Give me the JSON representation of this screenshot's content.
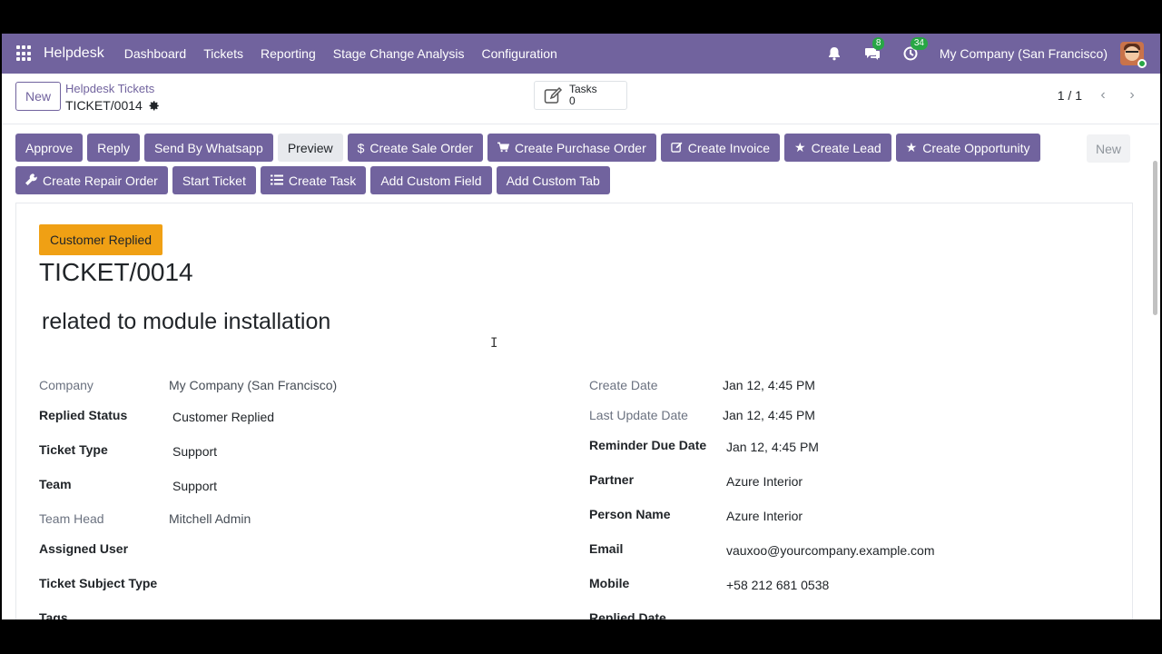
{
  "navbar": {
    "brand": "Helpdesk",
    "items": [
      "Dashboard",
      "Tickets",
      "Reporting",
      "Stage Change Analysis",
      "Configuration"
    ],
    "messages_count": "8",
    "activities_count": "34",
    "company": "My Company (San Francisco)"
  },
  "control": {
    "new_label": "New",
    "breadcrumb_parent": "Helpdesk Tickets",
    "breadcrumb_current": "TICKET/0014",
    "tasks_label": "Tasks",
    "tasks_count": "0",
    "pager": "1 / 1"
  },
  "actions": {
    "row1": [
      "Approve",
      "Reply",
      "Send By Whatsapp",
      "Preview",
      "Create Sale Order",
      "Create Purchase Order",
      "Create Invoice",
      "Create Lead",
      "Create Opportunity"
    ],
    "row2": [
      "Create Repair Order",
      "Start Ticket",
      "Create Task",
      "Add Custom Field",
      "Add Custom Tab"
    ],
    "new_right": "New"
  },
  "ticket": {
    "stage": "Customer Replied",
    "name": "TICKET/0014",
    "subject": "related to module installation"
  },
  "fields_left": [
    {
      "label": "Company",
      "value": "My Company (San Francisco)"
    },
    {
      "label": "Replied Status",
      "value": "Customer Replied"
    },
    {
      "label": "Ticket Type",
      "value": "Support"
    },
    {
      "label": "Team",
      "value": "Support"
    },
    {
      "label": "Team Head",
      "value": "Mitchell Admin"
    },
    {
      "label": "Assigned User",
      "value": ""
    },
    {
      "label": "Ticket Subject Type",
      "value": ""
    },
    {
      "label": "Tags",
      "value": ""
    }
  ],
  "fields_right": [
    {
      "label": "Create Date",
      "value": "Jan 12, 4:45 PM"
    },
    {
      "label": "Last Update Date",
      "value": "Jan 12, 4:45 PM"
    },
    {
      "label": "Reminder Due Date",
      "value": "Jan 12, 4:45 PM"
    },
    {
      "label": "Partner",
      "value": "Azure Interior"
    },
    {
      "label": "Person Name",
      "value": "Azure Interior"
    },
    {
      "label": "Email",
      "value": "vauxoo@yourcompany.example.com"
    },
    {
      "label": "Mobile",
      "value": "+58 212 681 0538"
    },
    {
      "label": "Replied Date",
      "value": ""
    }
  ]
}
